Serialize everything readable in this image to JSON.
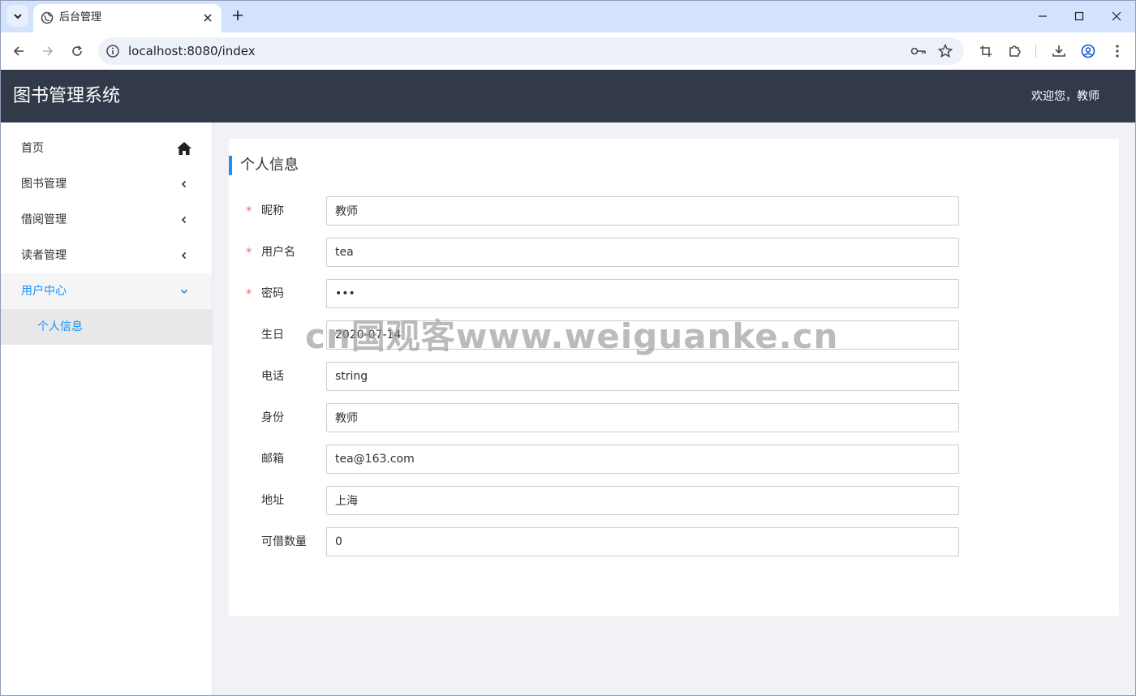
{
  "browser": {
    "tab_title": "后台管理",
    "url": "localhost:8080/index"
  },
  "app": {
    "title": "图书管理系统",
    "welcome": "欢迎您，教师"
  },
  "sidebar": {
    "items": [
      {
        "label": "首页",
        "icon": "home-icon"
      },
      {
        "label": "图书管理",
        "icon": "chevron-left-icon"
      },
      {
        "label": "借阅管理",
        "icon": "chevron-left-icon"
      },
      {
        "label": "读者管理",
        "icon": "chevron-left-icon"
      },
      {
        "label": "用户中心",
        "icon": "chevron-down-icon",
        "expanded": true
      },
      {
        "label": "个人信息",
        "sub": true,
        "active": true
      }
    ]
  },
  "main": {
    "title": "个人信息",
    "form": [
      {
        "label": "昵称",
        "required": true,
        "value": "教师"
      },
      {
        "label": "用户名",
        "required": true,
        "value": "tea"
      },
      {
        "label": "密码",
        "required": true,
        "value": "•••"
      },
      {
        "label": "生日",
        "required": false,
        "value": "2020-07-14"
      },
      {
        "label": "电话",
        "required": false,
        "value": "string"
      },
      {
        "label": "身份",
        "required": false,
        "value": "教师"
      },
      {
        "label": "邮箱",
        "required": false,
        "value": "tea@163.com"
      },
      {
        "label": "地址",
        "required": false,
        "value": "上海"
      },
      {
        "label": "可借数量",
        "required": false,
        "value": "0"
      }
    ]
  },
  "watermark": "cn国观客www.weiguanke.cn",
  "colors": {
    "header_bg": "#323a4a",
    "accent": "#1890ff",
    "required": "#f56c6c",
    "tabstrip": "#d3e3fd"
  }
}
